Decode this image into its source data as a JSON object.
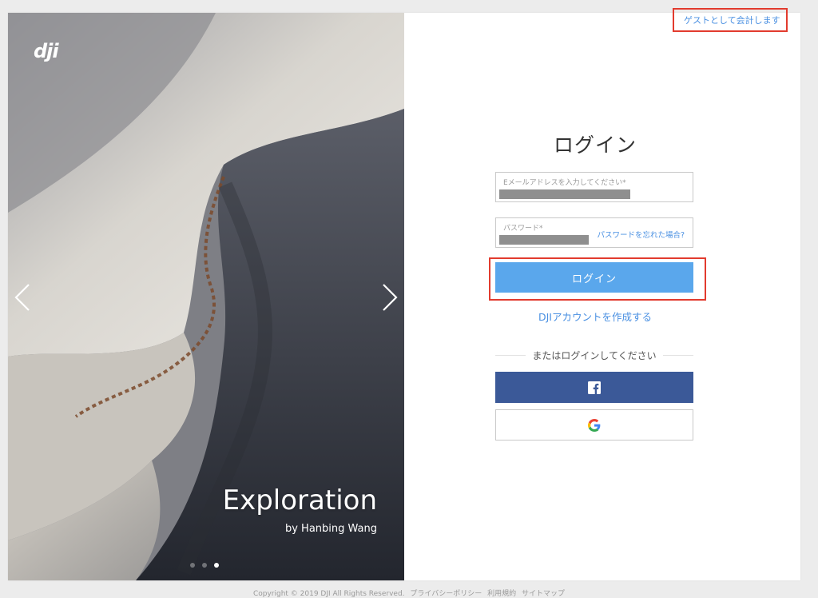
{
  "brand": {
    "logo_text": "dji"
  },
  "hero": {
    "title": "Exploration",
    "author": "by Hanbing Wang",
    "slides_total": 3,
    "active_slide": 3
  },
  "header": {
    "guest_link": "ゲストとして会計します"
  },
  "login": {
    "title": "ログイン",
    "email_label": "Eメールアドレスを入力してください*",
    "password_label": "パスワード*",
    "forgot_password": "パスワードを忘れた場合?",
    "submit_label": "ログイン",
    "create_account": "DJIアカウントを作成する",
    "divider_text": "またはログインしてください"
  },
  "social": {
    "facebook_icon": "facebook-icon",
    "google_icon": "google-icon",
    "facebook_color": "#3b5998"
  },
  "colors": {
    "accent": "#5aa7ec",
    "link": "#4a90e2",
    "highlight": "#e23b2e"
  },
  "footer": {
    "copyright": "Copyright © 2019 DJI All Rights Reserved.",
    "links": [
      "プライバシーポリシー",
      "利用規約",
      "サイトマップ"
    ]
  }
}
